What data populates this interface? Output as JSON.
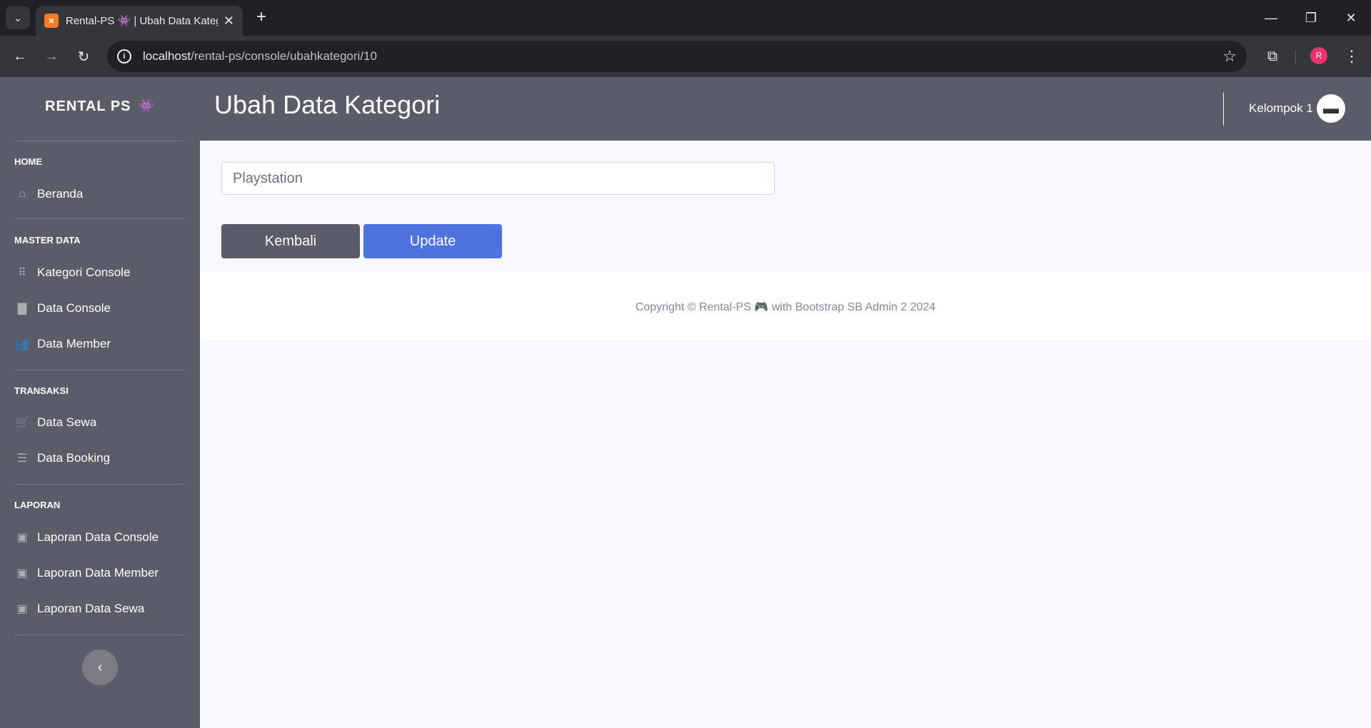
{
  "browser": {
    "tab_title": "Rental-PS 👾 | Ubah Data Kategori",
    "url_host": "localhost",
    "url_path": "/rental-ps/console/ubahkategori/10",
    "profile_initial": "R",
    "icons": {
      "favicon": "xampp-icon",
      "back": "arrow-left-icon",
      "forward": "arrow-right-icon",
      "reload": "reload-icon",
      "bookmark": "star-icon",
      "extensions": "puzzle-icon",
      "menu": "kebab-icon"
    }
  },
  "sidebar": {
    "brand": "RENTAL PS",
    "brand_emoji": "🎮",
    "sections": [
      {
        "heading": "HOME",
        "items": [
          {
            "label": "Beranda",
            "icon": "home-icon"
          }
        ]
      },
      {
        "heading": "MASTER DATA",
        "items": [
          {
            "label": "Kategori Console",
            "icon": "th-icon"
          },
          {
            "label": "Data Console",
            "icon": "book-icon"
          },
          {
            "label": "Data Member",
            "icon": "users-icon"
          }
        ]
      },
      {
        "heading": "TRANSAKSI",
        "items": [
          {
            "label": "Data Sewa",
            "icon": "cart-icon"
          },
          {
            "label": "Data Booking",
            "icon": "list-icon"
          }
        ]
      },
      {
        "heading": "LAPORAN",
        "items": [
          {
            "label": "Laporan Data Console",
            "icon": "report-icon"
          },
          {
            "label": "Laporan Data Member",
            "icon": "report-icon"
          },
          {
            "label": "Laporan Data Sewa",
            "icon": "report-icon"
          }
        ]
      }
    ]
  },
  "topbar": {
    "title": "Ubah Data Kategori",
    "user_name": "Kelompok 1"
  },
  "form": {
    "category_value": "Playstation",
    "back_label": "Kembali",
    "update_label": "Update"
  },
  "footer": {
    "text_before": "Copyright © Rental-PS",
    "text_emoji": "🎮",
    "text_after": "with Bootstrap SB Admin 2 2024"
  },
  "colors": {
    "sidebar_bg": "#5a5c69",
    "primary": "#4e73df",
    "secondary": "#5a5c69",
    "page_bg": "#f8f9fc"
  }
}
